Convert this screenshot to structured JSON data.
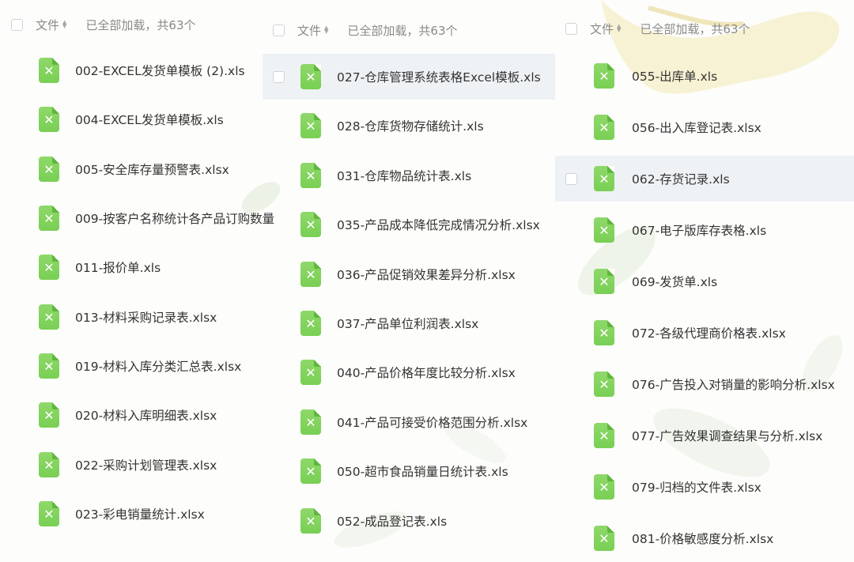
{
  "colors": {
    "accent": "#7ed35a",
    "text": "#333333",
    "muted": "#8a8a8a"
  },
  "columns": [
    {
      "header": {
        "file_label": "文件",
        "status": "已全部加载，共63个"
      },
      "files": [
        "002-EXCEL发货单模板 (2).xls",
        "004-EXCEL发货单模板.xls",
        "005-安全库存量预警表.xlsx",
        "009-按客户名称统计各产品订购数量",
        "011-报价单.xls",
        "013-材料采购记录表.xlsx",
        "019-材料入库分类汇总表.xlsx",
        "020-材料入库明细表.xlsx",
        "022-采购计划管理表.xlsx",
        "023-彩电销量统计.xlsx"
      ]
    },
    {
      "header": {
        "file_label": "文件",
        "status": "已全部加载，共63个"
      },
      "files": [
        "027-仓库管理系统表格Excel模板.xls",
        "028-仓库货物存储统计.xls",
        "031-仓库物品统计表.xls",
        "035-产品成本降低完成情况分析.xlsx",
        "036-产品促销效果差异分析.xlsx",
        "037-产品单位利润表.xlsx",
        "040-产品价格年度比较分析.xlsx",
        "041-产品可接受价格范围分析.xlsx",
        "050-超市食品销量日统计表.xls",
        "052-成品登记表.xls"
      ]
    },
    {
      "header": {
        "file_label": "文件",
        "status": "已全部加载，共63个"
      },
      "files": [
        "055-出库单.xls",
        "056-出入库登记表.xlsx",
        "062-存货记录.xls",
        "067-电子版库存表格.xls",
        "069-发货单.xls",
        "072-各级代理商价格表.xlsx",
        "076-广告投入对销量的影响分析.xlsx",
        "077-广告效果调查结果与分析.xlsx",
        "079-归档的文件表.xlsx",
        "081-价格敏感度分析.xlsx"
      ]
    }
  ]
}
